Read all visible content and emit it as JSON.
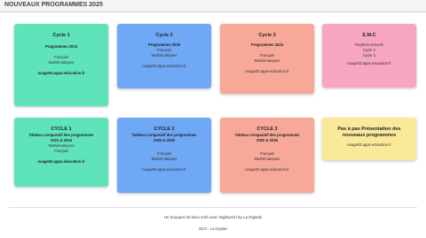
{
  "header": {
    "title": "NOUVEAUX PROGRAMMES 2025"
  },
  "cards": [
    {
      "title": "Cycle 1",
      "lines": [
        "Programmes 2024",
        "",
        "Français",
        "Mathématiques"
      ],
      "link": "nuage03.apps.education.fr"
    },
    {
      "title": "Cycle 2",
      "lines": [
        "Programmes 2025",
        "Français",
        "Mathématiques"
      ],
      "link": "nuage03.apps.education.fr"
    },
    {
      "title": "Cycle 3",
      "lines": [
        "Programmes 2024",
        "",
        "Français",
        "Mathématiques"
      ],
      "link": "nuage03.apps.education.fr"
    },
    {
      "title": "E.M.C",
      "lines": [
        "Repères annuels",
        "Cycle 2",
        "Cycle 3"
      ],
      "link": "nuage03.apps.education.fr"
    },
    {
      "title": "CYCLE 1",
      "lines": [
        "Tableau comparatif des programmes",
        "2021 & 2024",
        "Mathématiques",
        "Français"
      ],
      "link": "nuage03.apps.education.fr"
    },
    {
      "title": "CYCLE 2",
      "lines": [
        "Tableau comparatif des programmes",
        "2020 & 2025",
        "",
        "Français",
        "Mathématiques"
      ],
      "link": "nuage03.apps.education.fr"
    },
    {
      "title": "CYCLE 3",
      "lines": [
        "Tableau comparatif des programmes",
        "2020 & 2025",
        "",
        "Français",
        "Mathématiques"
      ],
      "link": "nuage03.apps.education.fr"
    },
    {
      "title": "Pas à pas Présentation des nouveaux programmes",
      "lines": [],
      "link": "nuage03.apps.education.fr"
    }
  ],
  "footer": {
    "credit": "Un bouquet de liens créé avec Digibunch by La Digitale",
    "copyright": "2023 - La Digitale"
  },
  "colors": {
    "green": "#5fe3ba",
    "blue": "#6fa8f4",
    "salmon": "#f7a898",
    "pink": "#f8a5c2",
    "yellow": "#fbe99a"
  }
}
